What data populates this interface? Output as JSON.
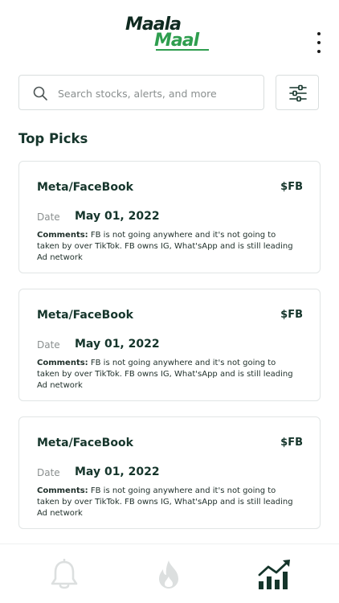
{
  "header": {
    "logo_line1": "Maala",
    "logo_line2": "Maal",
    "menu_icon": "more-vertical-icon"
  },
  "search": {
    "placeholder": "Search stocks, alerts, and more",
    "value": "",
    "icon": "search-icon"
  },
  "filter": {
    "icon": "sliders-icon"
  },
  "section": {
    "title": "Top Picks"
  },
  "cards": [
    {
      "name": "Meta/FaceBook",
      "ticker": "$FB",
      "date_label": "Date",
      "date": "May 01, 2022",
      "comments_label": "Comments:",
      "comments": "FB is not going anywhere and it's not going to taken by over TikTok. FB owns IG, What'sApp and is still leading Ad network"
    },
    {
      "name": "Meta/FaceBook",
      "ticker": "$FB",
      "date_label": "Date",
      "date": "May 01, 2022",
      "comments_label": "Comments:",
      "comments": "FB is not going anywhere and it's not going to taken by over TikTok. FB owns IG, What'sApp and is still leading Ad network"
    },
    {
      "name": "Meta/FaceBook",
      "ticker": "$FB",
      "date_label": "Date",
      "date": "May 01, 2022",
      "comments_label": "Comments:",
      "comments": "FB is not going anywhere and it's not going to taken by over TikTok. FB owns IG, What'sApp and is still leading Ad network"
    }
  ],
  "bottom_nav": [
    {
      "icon": "bell-icon",
      "active": false
    },
    {
      "icon": "fire-icon",
      "active": false
    },
    {
      "icon": "chart-growth-icon",
      "active": true
    }
  ],
  "colors": {
    "primary": "#15352b",
    "accent": "#2f9e4f",
    "inactive": "#dcdfdf",
    "muted": "#8a8f8f"
  }
}
